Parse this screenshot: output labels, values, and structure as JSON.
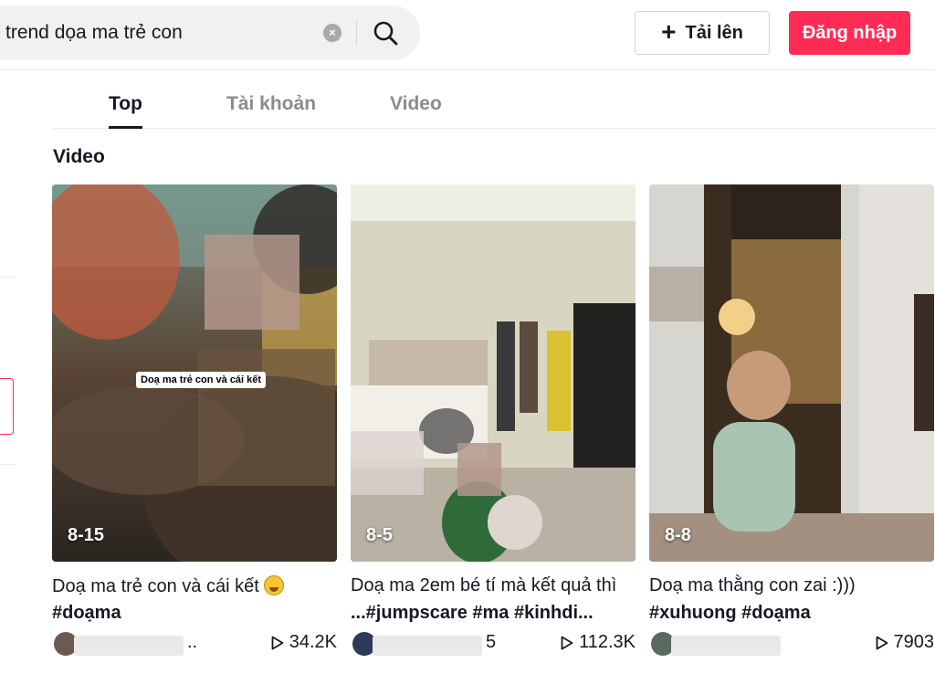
{
  "header": {
    "search_value": "trend dọa ma trẻ con",
    "upload_label": "Tải lên",
    "login_label": "Đăng nhập",
    "accent_color": "#fe2c55"
  },
  "tabs": [
    {
      "label": "Top",
      "active": true
    },
    {
      "label": "Tài khoản",
      "active": false
    },
    {
      "label": "Video",
      "active": false
    }
  ],
  "section_title": "Video",
  "videos": [
    {
      "date": "8-15",
      "overlay_caption": "Doạ ma trẻ con và cái kết",
      "description": "Doạ ma trẻ con và cái kết",
      "description_emoji": "laughing-face-icon",
      "hashtags": "#doạma",
      "author_tail": "..",
      "views": "34.2K"
    },
    {
      "date": "8-5",
      "description": "Doạ ma 2em bé tí mà kết quả thì",
      "hashtags": "...#jumpscare #ma #kinhdi...",
      "author_tail": "5",
      "views": "112.3K"
    },
    {
      "date": "8-8",
      "description": "Doạ ma thằng con zai :)))",
      "hashtags": "#xuhuong #doạma",
      "author_tail": "",
      "views": "7903"
    }
  ]
}
